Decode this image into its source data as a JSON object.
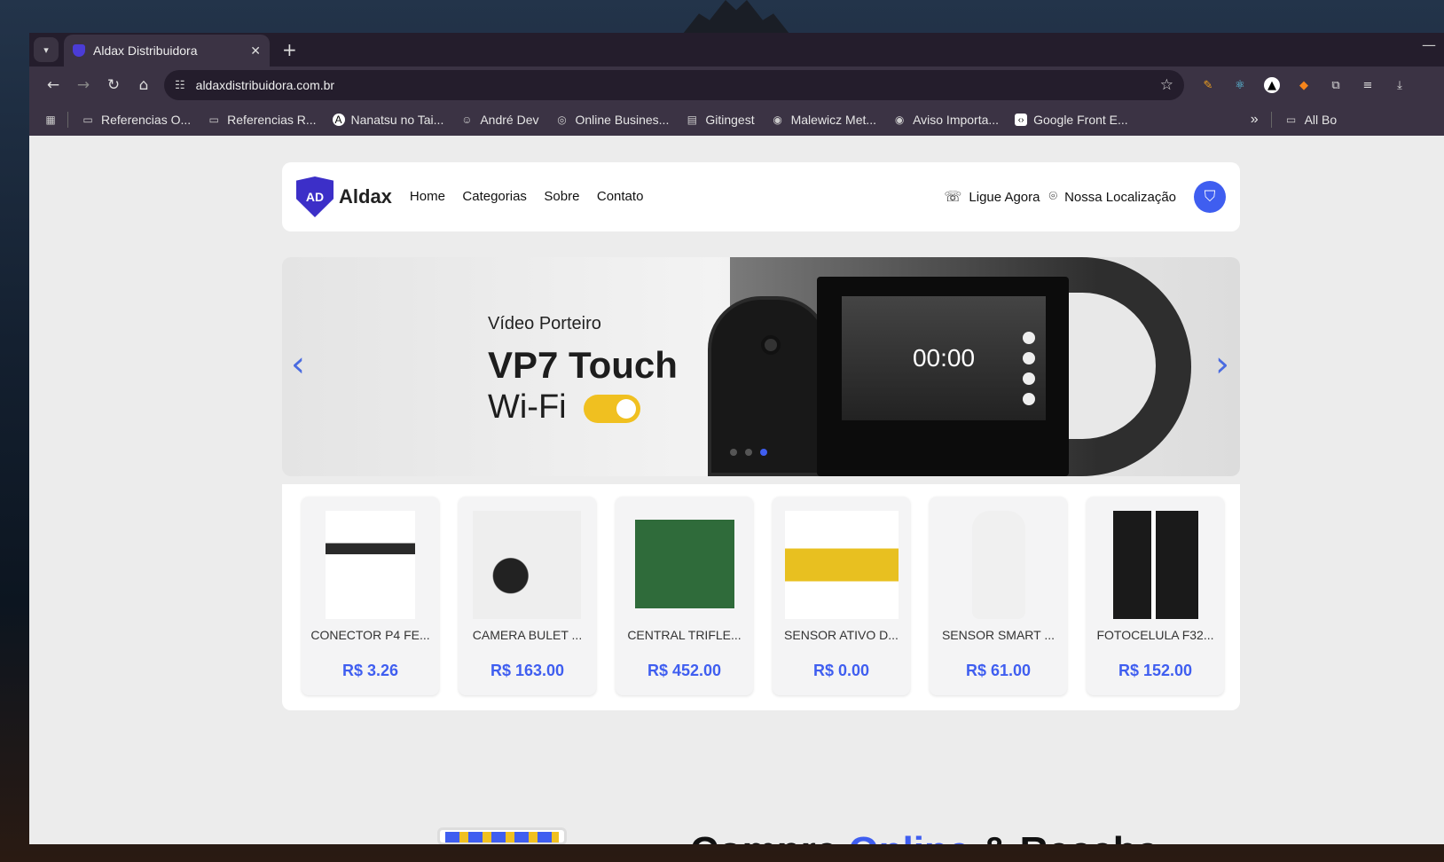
{
  "browser": {
    "tab_title": "Aldax Distribuidora",
    "new_tab_symbol": "+",
    "url": "aldaxdistribuidora.com.br",
    "bookmarks": [
      {
        "label": "Referencias O...",
        "icon": "folder-icon"
      },
      {
        "label": "Referencias R...",
        "icon": "folder-icon"
      },
      {
        "label": "Nanatsu no Tai...",
        "icon": "a-logo-icon"
      },
      {
        "label": "André Dev",
        "icon": "avatar-icon"
      },
      {
        "label": "Online Busines...",
        "icon": "globe-icon"
      },
      {
        "label": "Gitingest",
        "icon": "document-icon"
      },
      {
        "label": "Malewicz Met...",
        "icon": "globe-icon"
      },
      {
        "label": "Aviso Importa...",
        "icon": "globe-icon"
      },
      {
        "label": "Google Front E...",
        "icon": "code-icon"
      }
    ],
    "more_bookmarks": "»",
    "all_bookmarks": "All Bo"
  },
  "site": {
    "brand": "Aldax",
    "logo_text": "AD",
    "nav": [
      "Home",
      "Categorias",
      "Sobre",
      "Contato"
    ],
    "call_label": "Ligue Agora",
    "location_label": "Nossa Localização",
    "accent_color": "#3f5ef0"
  },
  "banner": {
    "subtitle": "Vídeo Porteiro",
    "title": "VP7 Touch",
    "wifi": "Wi-Fi",
    "clock": "00:00",
    "prev": "‹",
    "next": "›",
    "active_slide": 3,
    "slide_count": 3
  },
  "products": [
    {
      "name": "CONECTOR P4 FE...",
      "price": "R$ 3.26"
    },
    {
      "name": "CAMERA BULET ...",
      "price": "R$ 163.00"
    },
    {
      "name": "CENTRAL TRIFLE...",
      "price": "R$ 452.00"
    },
    {
      "name": "SENSOR ATIVO D...",
      "price": "R$ 0.00"
    },
    {
      "name": "SENSOR SMART ...",
      "price": "R$ 61.00"
    },
    {
      "name": "FOTOCELULA F32...",
      "price": "R$ 152.00"
    }
  ],
  "section": {
    "heading_a": "Compre ",
    "heading_b": "Online",
    "heading_c": " & Receba"
  }
}
